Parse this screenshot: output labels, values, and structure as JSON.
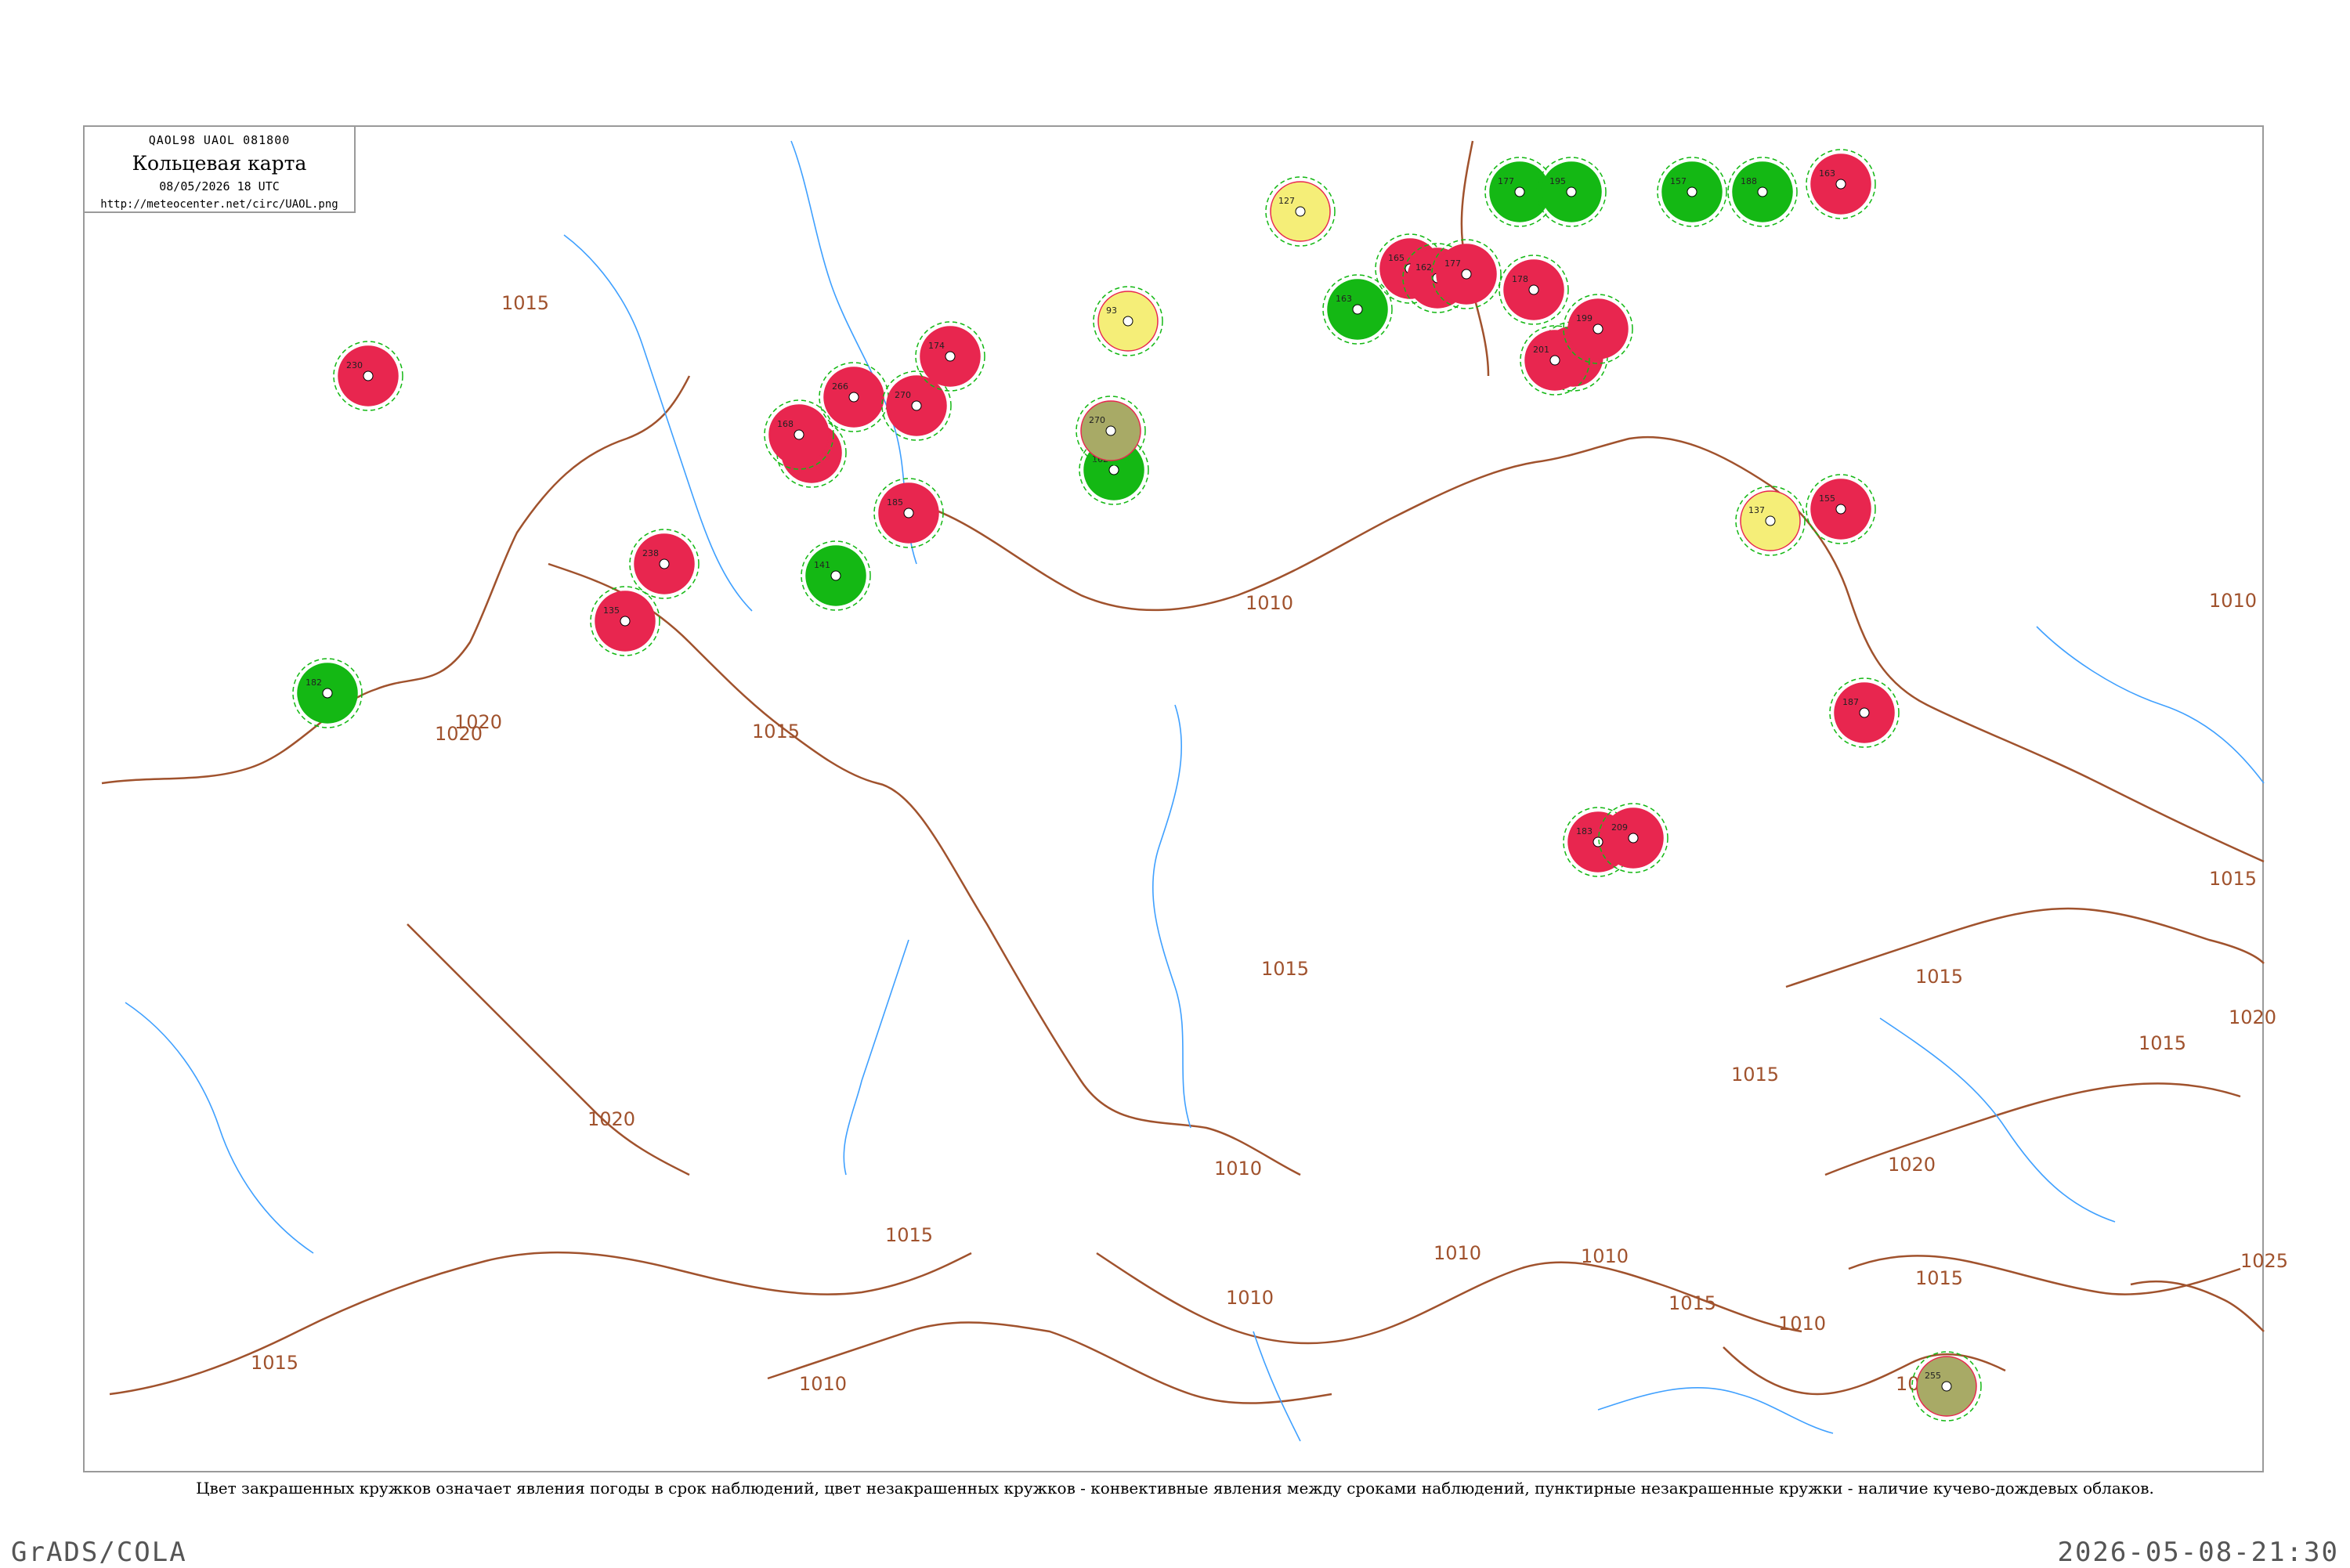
{
  "header": {
    "code_line": "QAOL98  UAOL  081800",
    "title": "Кольцевая карта",
    "datetime": "08/05/2026 18 UTC",
    "url": "http://meteocenter.net/circ/UAOL.png"
  },
  "caption": "Цвет закрашенных кружков означает явления погоды в срок наблюдений, цвет незакрашенных кружков - конвективные явления между сроками наблюдений, пунктирные незакрашенные кружки - наличие кучево-дождевых облаков.",
  "footer": {
    "left": "GrADS/COLA",
    "right": "2026-05-08-21:30"
  },
  "colors": {
    "isobar": "#a0522d",
    "river": "#3fa0ff",
    "thunder_fill": "#e8264f",
    "rain_fill": "#14b814",
    "haze_fill": "#f5ee78",
    "dust_fill": "#a8aa66",
    "cb_circle": "#14b814",
    "conv_circle": "#e8264f"
  },
  "isobar_labels": [
    "1015",
    "1015",
    "1015",
    "1010",
    "1010",
    "1020",
    "1015",
    "1010",
    "1010",
    "1015",
    "1015",
    "1020",
    "1020",
    "1015",
    "1025",
    "1010",
    "1015",
    "1015",
    "1010",
    "1020",
    "1020",
    "1015",
    "1010",
    "1010",
    "1015",
    "1020"
  ],
  "stations": [
    {
      "label": "230",
      "type": "thunder"
    },
    {
      "label": "135",
      "type": "thunder"
    },
    {
      "label": "238",
      "type": "thunder"
    },
    {
      "label": "256",
      "type": "thunder"
    },
    {
      "label": "266",
      "type": "thunder"
    },
    {
      "label": "270",
      "type": "thunder"
    },
    {
      "label": "174",
      "type": "thunder"
    },
    {
      "label": "168",
      "type": "thunder"
    },
    {
      "label": "185",
      "type": "thunder"
    },
    {
      "label": "165",
      "type": "thunder"
    },
    {
      "label": "162",
      "type": "thunder"
    },
    {
      "label": "177",
      "type": "thunder"
    },
    {
      "label": "178",
      "type": "thunder"
    },
    {
      "label": "182",
      "type": "thunder"
    },
    {
      "label": "163",
      "type": "thunder"
    },
    {
      "label": "155",
      "type": "thunder"
    },
    {
      "label": "187",
      "type": "thunder"
    },
    {
      "label": "183",
      "type": "thunder"
    },
    {
      "label": "209",
      "type": "thunder"
    },
    {
      "label": "201",
      "type": "thunder"
    },
    {
      "label": "199",
      "type": "thunder"
    },
    {
      "label": "182",
      "type": "rain"
    },
    {
      "label": "141",
      "type": "rain"
    },
    {
      "label": "162",
      "type": "rain"
    },
    {
      "label": "163",
      "type": "rain"
    },
    {
      "label": "177",
      "type": "rain"
    },
    {
      "label": "195",
      "type": "rain"
    },
    {
      "label": "157",
      "type": "rain"
    },
    {
      "label": "188",
      "type": "rain"
    },
    {
      "label": "137",
      "type": "haze"
    },
    {
      "label": "93",
      "type": "haze"
    },
    {
      "label": "127",
      "type": "haze"
    },
    {
      "label": "270",
      "type": "dust"
    },
    {
      "label": "255",
      "type": "dust"
    }
  ]
}
